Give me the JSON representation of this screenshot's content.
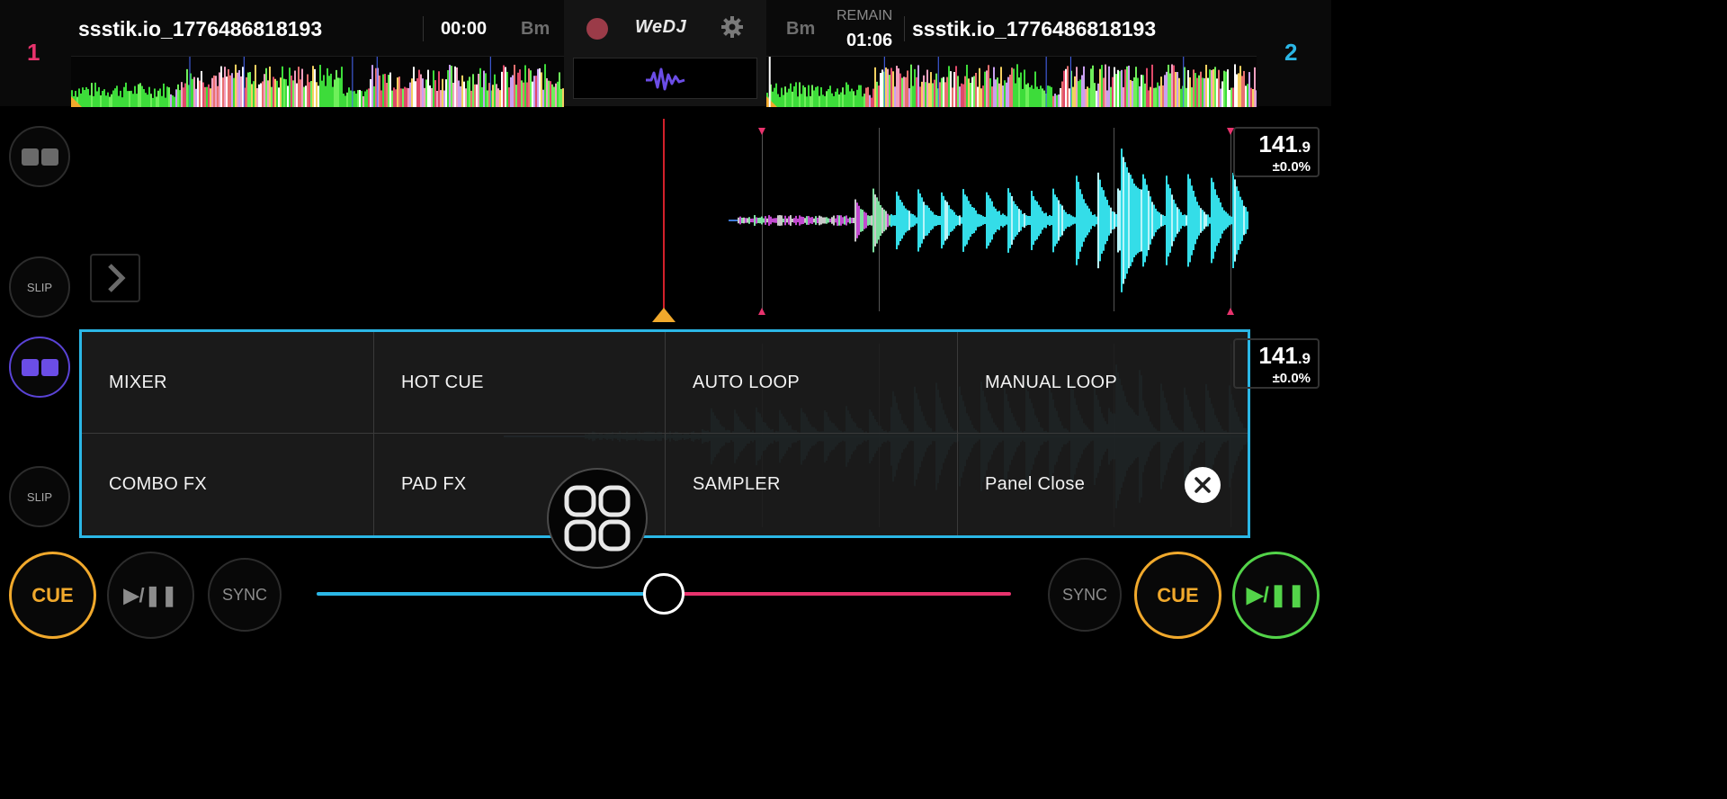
{
  "deck1": {
    "number": "1",
    "title": "ssstik.io_1776486818193",
    "time": "00:00",
    "key": "Bm",
    "bpm": "141",
    "bpm_decimal": ".9",
    "pitch": "±0.0%"
  },
  "deck2": {
    "number": "2",
    "title": "ssstik.io_1776486818193",
    "remain_label": "REMAIN",
    "time": "01:06",
    "key": "Bm",
    "bpm": "141",
    "bpm_decimal": ".9",
    "pitch": "±0.0%"
  },
  "center": {
    "logo": "WeDJ"
  },
  "left_controls": {
    "slip_top": "SLIP",
    "slip_bottom": "SLIP"
  },
  "panel": {
    "items": [
      "MIXER",
      "HOT CUE",
      "AUTO LOOP",
      "MANUAL LOOP",
      "COMBO FX",
      "PAD FX",
      "SAMPLER",
      "Panel Close"
    ]
  },
  "transport": {
    "cue_left": "CUE",
    "play_left": "▶/❚❚",
    "sync_left": "SYNC",
    "sync_right": "SYNC",
    "cue_right": "CUE",
    "play_right": "▶/❚❚"
  },
  "crossfader": {
    "position": 0.5
  },
  "colors": {
    "deck1_accent": "#e8336d",
    "deck2_accent": "#2bb7e6",
    "cue": "#f1a92c",
    "play_active": "#53d449",
    "panel_border": "#2bb7e6"
  },
  "icons": {
    "record": "record-icon",
    "settings": "gear-icon",
    "waveform": "waveform-icon",
    "panel_toggle": "grid-icon",
    "close": "close-icon",
    "expand": "chevron-right-icon"
  }
}
